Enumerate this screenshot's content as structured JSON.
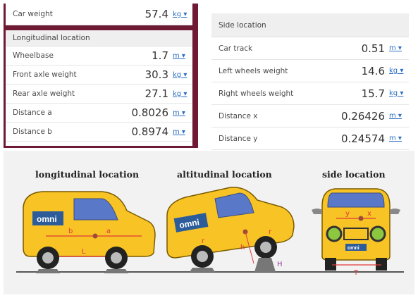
{
  "left_panel": {
    "car_weight": {
      "label": "Car weight",
      "value": "57.4",
      "unit": "kg"
    },
    "header": "Longitudinal location",
    "rows": [
      {
        "label": "Wheelbase",
        "value": "1.7",
        "unit": "m"
      },
      {
        "label": "Front axle weight",
        "value": "30.3",
        "unit": "kg"
      },
      {
        "label": "Rear axle weight",
        "value": "27.1",
        "unit": "kg"
      },
      {
        "label": "Distance a",
        "value": "0.8026",
        "unit": "m"
      },
      {
        "label": "Distance b",
        "value": "0.8974",
        "unit": "m"
      }
    ]
  },
  "right_panel": {
    "header": "Side location",
    "rows": [
      {
        "label": "Car track",
        "value": "0.51",
        "unit": "m"
      },
      {
        "label": "Left wheels weight",
        "value": "14.6",
        "unit": "kg"
      },
      {
        "label": "Right wheels weight",
        "value": "15.7",
        "unit": "kg"
      },
      {
        "label": "Distance x",
        "value": "0.26426",
        "unit": "m"
      },
      {
        "label": "Distance y",
        "value": "0.24574",
        "unit": "m"
      }
    ]
  },
  "illustration": {
    "titles": [
      "longitudinal location",
      "altitudinal location",
      "side location"
    ],
    "logo": "omni",
    "labels": {
      "b": "b",
      "a": "a",
      "L": "L",
      "r": "r",
      "h": "h",
      "H": "H",
      "y": "y",
      "x": "x",
      "T": "T"
    }
  },
  "colors": {
    "accent": "#6e1a35",
    "car": "#f7c325",
    "link": "#2a6fc4",
    "red": "#e23a3a"
  }
}
